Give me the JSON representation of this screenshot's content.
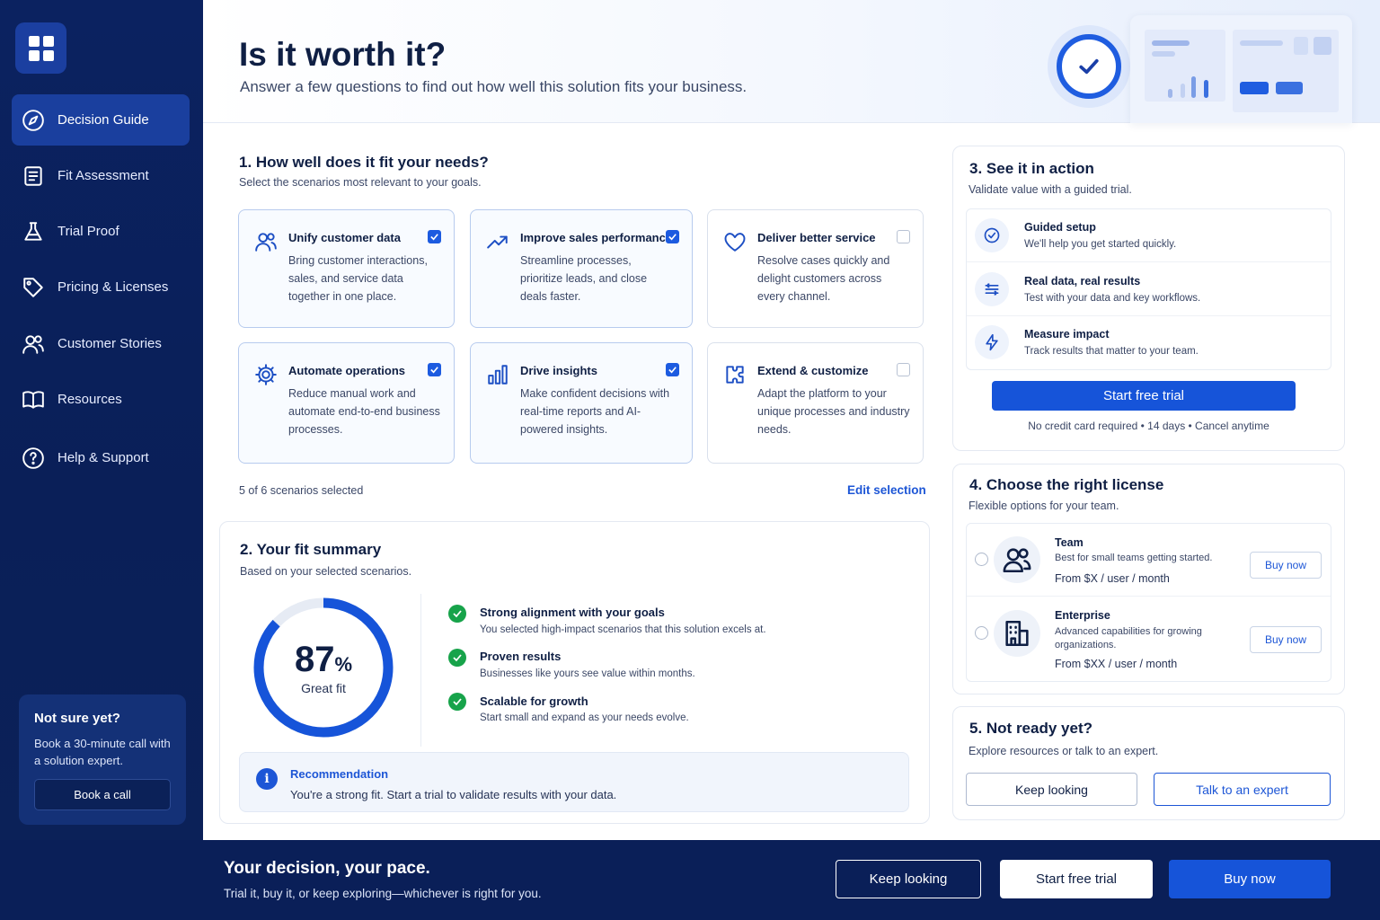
{
  "sidebar": {
    "items": [
      {
        "label": "Decision Guide",
        "icon": "compass-icon",
        "active": true
      },
      {
        "label": "Fit Assessment",
        "icon": "checklist-icon"
      },
      {
        "label": "Trial Proof",
        "icon": "flask-icon"
      },
      {
        "label": "Pricing & Licenses",
        "icon": "tag-icon"
      },
      {
        "label": "Customer Stories",
        "icon": "users-icon"
      },
      {
        "label": "Resources",
        "icon": "book-icon"
      },
      {
        "label": "Help & Support",
        "icon": "help-icon"
      }
    ],
    "help_card": {
      "title": "Not sure yet?",
      "text": "Book a 30-minute call with a solution expert.",
      "button": "Book a call"
    }
  },
  "header": {
    "title": "Is it worth it?",
    "subtitle": "Answer a few questions to find out how well this solution fits your business."
  },
  "needs": {
    "title": "1. How well does it fit your needs?",
    "subtitle": "Select the scenarios most relevant to your goals.",
    "cards": [
      {
        "title": "Unify customer data",
        "desc": "Bring customer interactions, sales, and service data together in one place.",
        "checked": true,
        "icon": "users-icon"
      },
      {
        "title": "Improve sales performance",
        "desc": "Streamline processes, prioritize leads, and close deals faster.",
        "checked": true,
        "icon": "trend-up-icon"
      },
      {
        "title": "Deliver better service",
        "desc": "Resolve cases quickly and delight customers across every channel.",
        "checked": false,
        "icon": "heart-icon"
      },
      {
        "title": "Automate operations",
        "desc": "Reduce manual work and automate end-to-end business processes.",
        "checked": true,
        "icon": "gear-icon"
      },
      {
        "title": "Drive insights",
        "desc": "Make confident decisions with real-time reports and AI-powered insights.",
        "checked": true,
        "icon": "bar-chart-icon"
      },
      {
        "title": "Extend & customize",
        "desc": "Adapt the platform to your unique processes and industry needs.",
        "checked": false,
        "icon": "puzzle-icon"
      }
    ],
    "selected_count": "5 of 6 scenarios selected",
    "edit_link": "Edit selection"
  },
  "summary": {
    "title": "2. Your fit summary",
    "subtitle": "Based on your selected scenarios.",
    "score": "87",
    "score_unit": "%",
    "score_fraction": 0.87,
    "score_label": "Great fit",
    "reasons": [
      {
        "title": "Strong alignment with your goals",
        "desc": "You selected high-impact scenarios that this solution excels at."
      },
      {
        "title": "Proven results",
        "desc": "Businesses like yours see value within months."
      },
      {
        "title": "Scalable for growth",
        "desc": "Start small and expand as your needs evolve."
      }
    ],
    "recommendation": {
      "title": "Recommendation",
      "text": "You're a strong fit. Start a trial to validate results with your data."
    }
  },
  "trial": {
    "title": "3. See it in action",
    "subtitle": "Validate value with a guided trial.",
    "items": [
      {
        "title": "Guided setup",
        "desc": "We'll help you get started quickly.",
        "icon": "check-badge-icon"
      },
      {
        "title": "Real data, real results",
        "desc": "Test with your data and key workflows.",
        "icon": "data-flow-icon"
      },
      {
        "title": "Measure impact",
        "desc": "Track results that matter to your team.",
        "icon": "bolt-icon"
      }
    ],
    "button": "Start free trial",
    "note": "No credit card required  •  14 days  •  Cancel anytime"
  },
  "license": {
    "title": "4. Choose the right license",
    "subtitle": "Flexible options for your team.",
    "options": [
      {
        "name": "Team",
        "desc": "Best for small teams getting started.",
        "price": "From $X / user / month",
        "button": "Buy now",
        "icon": "team-icon"
      },
      {
        "name": "Enterprise",
        "desc": "Advanced capabilities for growing organizations.",
        "price": "From $XX / user / month",
        "button": "Buy now",
        "icon": "building-icon"
      }
    ]
  },
  "not_ready": {
    "title": "5. Not ready yet?",
    "subtitle": "Explore resources or talk to an expert.",
    "keep_looking": "Keep looking",
    "talk_expert": "Talk to an expert"
  },
  "footer": {
    "title": "Your decision, your pace.",
    "subtitle": "Trial it, buy it, or keep exploring—whichever is right for you.",
    "keep_looking": "Keep looking",
    "start_trial": "Start free trial",
    "buy_now": "Buy now"
  },
  "colors": {
    "brand": "#1654d9",
    "navy": "#0a1f58",
    "success": "#17a34a"
  }
}
